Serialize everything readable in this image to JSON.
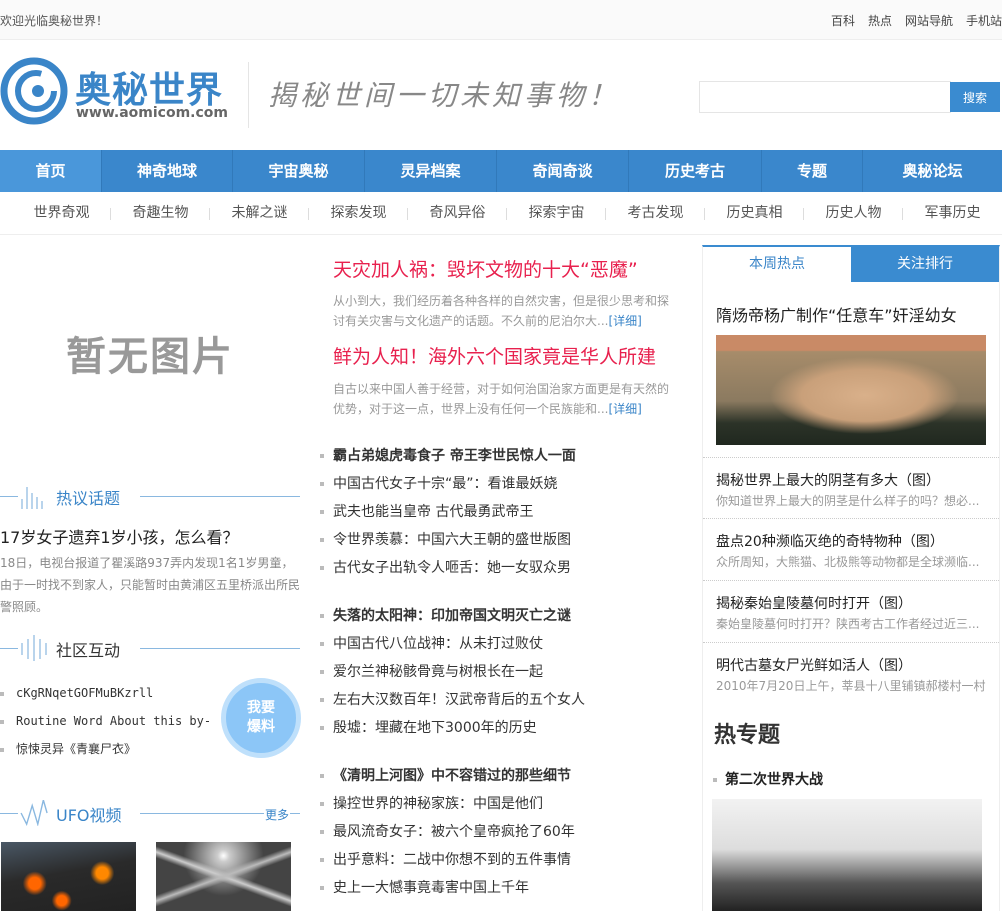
{
  "topbar": {
    "welcome": "欢迎光临奥秘世界！",
    "links": [
      "百科",
      "热点",
      "网站导航",
      "手机站"
    ]
  },
  "header": {
    "logo_name": "奥秘世界",
    "logo_url": "www.aomicom.com",
    "slogan": "揭秘世间一切未知事物！",
    "search_placeholder": "",
    "search_button": "搜索"
  },
  "nav": [
    "首页",
    "神奇地球",
    "宇宙奥秘",
    "灵异档案",
    "奇闻奇谈",
    "历史考古",
    "专题",
    "奥秘论坛"
  ],
  "subnav": [
    "世界奇观",
    "奇趣生物",
    "未解之谜",
    "探索发现",
    "奇风异俗",
    "探索宇宙",
    "考古发现",
    "历史真相",
    "历史人物",
    "军事历史"
  ],
  "left": {
    "no_image": "暂无图片",
    "hot_topic": {
      "heading": "热议话题",
      "title": "17岁女子遗弃1岁小孩，怎么看？",
      "desc": "18日，电视台报道了瞿溪路937弄内发现1名1岁男童，由于一时找不到家人，只能暂时由黄浦区五里桥派出所民警照顾。"
    },
    "community": {
      "heading": "社区互动",
      "items": [
        "cKgRNqetGOFMuBKzrll",
        "Routine Word About this by-",
        "惊悚灵异《青襄尸衣》"
      ],
      "bubble": [
        "我要",
        "爆料"
      ]
    },
    "ufo": {
      "heading": "UFO视频",
      "more": "更多"
    }
  },
  "middle": {
    "headlines": [
      {
        "title": "天灾加人祸：毁坏文物的十大“恶魔”",
        "desc": "从小到大，我们经历着各种各样的自然灾害，但是很少思考和探讨有关灾害与文化遗产的话题。不久前的尼泊尔大...",
        "more": "[详细]"
      },
      {
        "title": "鲜为人知！海外六个国家竟是华人所建",
        "desc": "自古以来中国人善于经营，对于如何治国治家方面更是有天然的优势，对于这一点，世界上没有任何一个民族能和...",
        "more": "[详细]"
      }
    ],
    "lists": [
      [
        "霸占弟媳虎毒食子 帝王李世民惊人一面",
        "中国古代女子十宗“最”：看谁最妖娆",
        "武夫也能当皇帝 古代最勇武帝王",
        "令世界羡慕：中国六大王朝的盛世版图",
        "古代女子出轨令人咂舌：她一女驭众男"
      ],
      [
        "失落的太阳神：印加帝国文明灭亡之谜",
        "中国古代八位战神：从未打过败仗",
        "爱尔兰神秘骸骨竟与树根长在一起",
        "左右大汉数百年！汉武帝背后的五个女人",
        "殷墟：埋藏在地下3000年的历史"
      ],
      [
        "《清明上河图》中不容错过的那些细节",
        "操控世界的神秘家族：中国是他们",
        "最风流奇女子：被六个皇帝疯抢了60年",
        "出乎意料：二战中你想不到的五件事情",
        "史上一大憾事竟毒害中国上千年"
      ]
    ]
  },
  "right": {
    "tabs": [
      "本周热点",
      "关注排行"
    ],
    "active_tab": "本周热点",
    "hot_title": "隋炀帝杨广制作“任意车”奸淫幼女",
    "items": [
      {
        "title": "揭秘世界上最大的阴茎有多大（图）",
        "desc": "你知道世界上最大的阴茎是什么样子的吗？想必..."
      },
      {
        "title": "盘点20种濒临灭绝的奇特物种（图）",
        "desc": "众所周知，大熊猫、北极熊等动物都是全球濒临..."
      },
      {
        "title": "揭秘秦始皇陵墓何时打开（图）",
        "desc": "秦始皇陵墓何时打开？陕西考古工作者经过近三..."
      },
      {
        "title": "明代古墓女尸光鲜如活人（图）",
        "desc": "2010年7月20日上午，莘县十八里铺镇郝楼村一村..."
      }
    ],
    "topic_heading": "热专题",
    "topic_item": "第二次世界大战"
  },
  "colors": {
    "brand_blue": "#3a87cc",
    "headline_red": "#e8214e"
  }
}
